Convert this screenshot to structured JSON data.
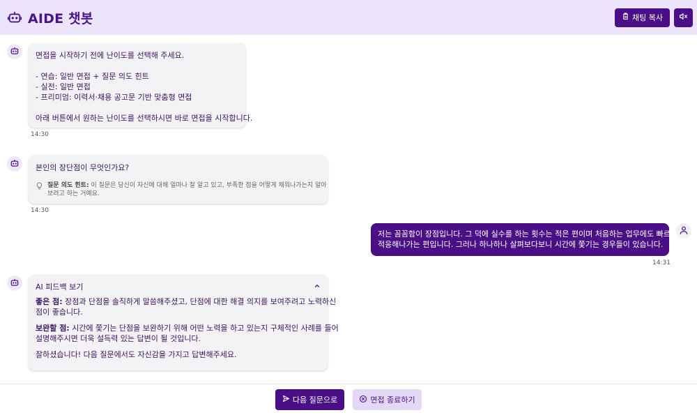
{
  "header": {
    "title": "AIDE 챗봇",
    "copy_label": "채팅 복사"
  },
  "messages": {
    "m1": {
      "lines": [
        "면접을 시작하기 전에 난이도를 선택해 주세요.",
        "- 연습: 일반 면접 + 질문 의도 힌트",
        "- 실전: 일반 면접",
        "- 프리미엄: 이력서·채용 공고문 기반 맞춤형 면접",
        "아래 버튼에서 원하는 난이도를 선택하시면 바로 면접을 시작합니다."
      ],
      "time": "14:30"
    },
    "m2": {
      "question": "본인의 장단점이 무엇인가요?",
      "hint_label": "질문 의도 힌트:",
      "hint_text1": "이 질문은 당신이 자신에 대해 얼마나 잘 알고 있고, 부족한 점을 어떻게 채워나가는지 알아",
      "hint_text2": "보려고 하는 거예요.",
      "time": "14:30"
    },
    "m3": {
      "line1": "저는 꼼꼼함이 장점입니다. 그 덕에 실수를 하는 횟수는 적은 편이며 처음하는 업무에도 빠르게",
      "line2": "적응해나가는 편입니다. 그러나 하나하나 살펴보다보니 시간에 쫓기는 경우들이 있습니다.",
      "time": "14:31"
    },
    "m4": {
      "title": "AI 피드백 보기",
      "good_label": "좋은 점:",
      "good_line1": "장점과 단점을 솔직하게 말씀해주셨고, 단점에 대한 해결 의지를 보여주려고 노력하신",
      "good_line2": "점이 좋습니다.",
      "improve_label": "보완할 점:",
      "improve_line1": "시간에 쫓기는 단점을 보완하기 위해 어떤 노력을 하고 있는지 구체적인 사례를 들어",
      "improve_line2": "설명해주시면 더욱 설득력 있는 답변이 될 것입니다.",
      "closing": "잘하셨습니다! 다음 질문에서도 자신감을 가지고 답변해주세요."
    }
  },
  "footer": {
    "next_label": "다음 질문으로",
    "end_label": "면접 종료하기"
  },
  "colors": {
    "primary": "#4a0e87",
    "header_bg": "#ece4fb",
    "bot_bubble": "#f3f2f4",
    "end_button_bg": "#e4d9f4"
  },
  "icons": {
    "brand": "robot-icon",
    "copy": "clipboard-icon",
    "mute": "speaker-mute-icon",
    "bot_avatar": "robot-icon",
    "user_avatar": "user-icon",
    "hint": "lightbulb-icon",
    "collapse": "chevron-up-icon",
    "send": "send-icon",
    "end": "circle-x-icon"
  }
}
